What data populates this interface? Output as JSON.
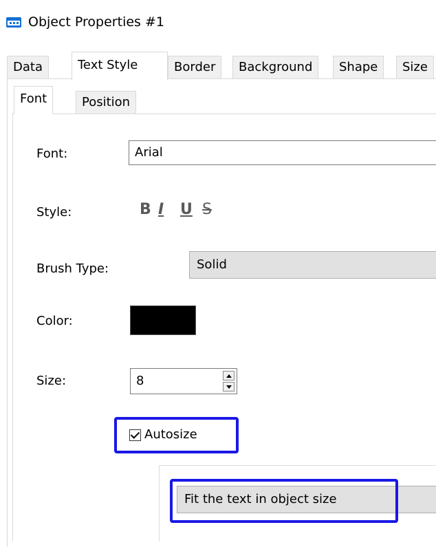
{
  "window": {
    "title": "Object Properties #1"
  },
  "tabs": [
    "Data",
    "Text Style",
    "Border",
    "Background",
    "Shape",
    "Size"
  ],
  "active_tab": "Text Style",
  "subtabs": [
    "Font",
    "Position"
  ],
  "active_subtab": "Font",
  "font_section": {
    "font_label": "Font:",
    "font_value": "Arial",
    "style_label": "Style:",
    "style_buttons": {
      "bold": "B",
      "italic": "I",
      "underline": "U",
      "strike": "S"
    },
    "brush_label": "Brush Type:",
    "brush_value": "Solid",
    "color_label": "Color:",
    "color_value": "#000000",
    "size_label": "Size:",
    "size_value": "8",
    "autosize_label": "Autosize",
    "autosize_checked": true,
    "fit_value": "Fit the text in object size"
  },
  "colors": {
    "highlight": "#1a18e5",
    "accent_icon": "#1570d4"
  }
}
